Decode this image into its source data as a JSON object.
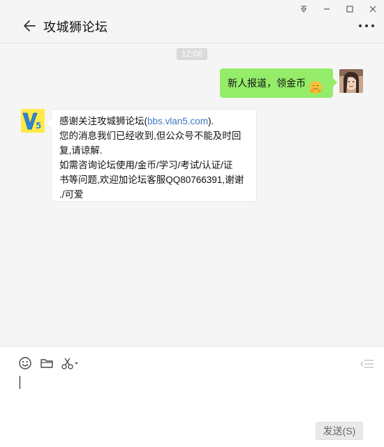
{
  "window": {
    "controls": [
      "pin-icon",
      "minimize-icon",
      "maximize-icon",
      "close-icon"
    ]
  },
  "header": {
    "title": "攻城狮论坛",
    "back_icon": "arrow-left-icon",
    "more_icon": "more-icon"
  },
  "chat": {
    "timestamp": "12:06",
    "messages": [
      {
        "sender": "me",
        "text": "新人报道，领金币",
        "emoji": "hugging-face-emoji"
      },
      {
        "sender": "bot",
        "avatar_text": "V5",
        "lines": [
          {
            "prefix": "感谢关注攻城狮论坛(",
            "link": "bbs.vlan5.com",
            "suffix": ")."
          },
          {
            "text": "您的消息我们已经收到,但公众号不能及时回"
          },
          {
            "text": "复,请谅解."
          },
          {
            "text": "如需咨询论坛使用/金币/学习/考试/认证/证"
          },
          {
            "text": "书等问题,欢迎加论坛客服QQ80766391,谢谢"
          },
          {
            "text": "./可爱"
          }
        ]
      }
    ]
  },
  "input": {
    "toolbar": [
      "smiley-icon",
      "folder-icon",
      "scissors-icon"
    ],
    "value": "",
    "send_label": "发送(S)"
  },
  "colors": {
    "my_bubble": "#95ec69",
    "link": "#3d7bc1",
    "bot_avatar_bg": "#ffe94a"
  }
}
